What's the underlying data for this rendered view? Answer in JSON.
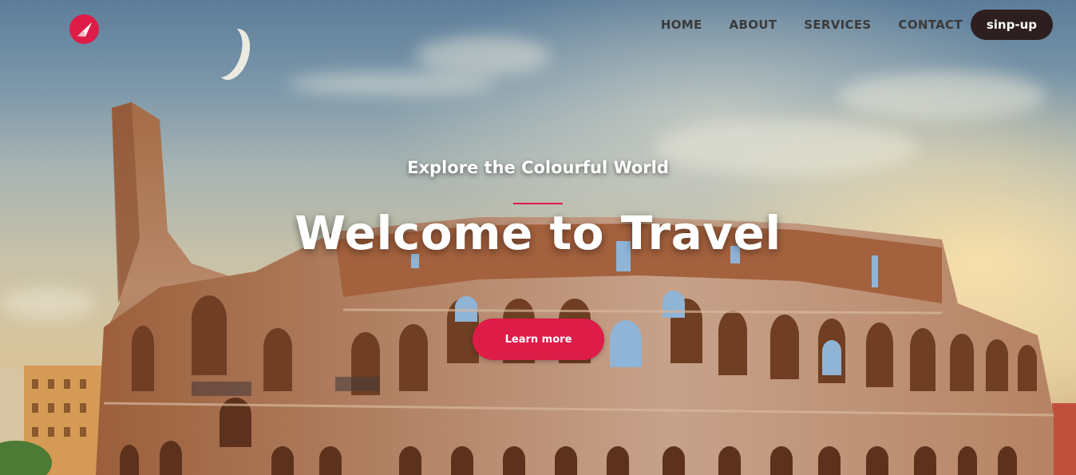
{
  "header": {
    "logo_icon": "paper-plane-icon",
    "nav": [
      {
        "label": "HOME"
      },
      {
        "label": "ABOUT"
      },
      {
        "label": "SERVICES"
      },
      {
        "label": "CONTACT"
      }
    ],
    "signup_label": "sinp-up"
  },
  "hero": {
    "subtitle": "Explore the Colourful World",
    "title": "Welcome to Travel",
    "cta_label": "Learn more"
  },
  "colors": {
    "accent": "#dd1c48",
    "signup_bg": "#2d1f1f",
    "nav_text": "#3b3b3b"
  }
}
